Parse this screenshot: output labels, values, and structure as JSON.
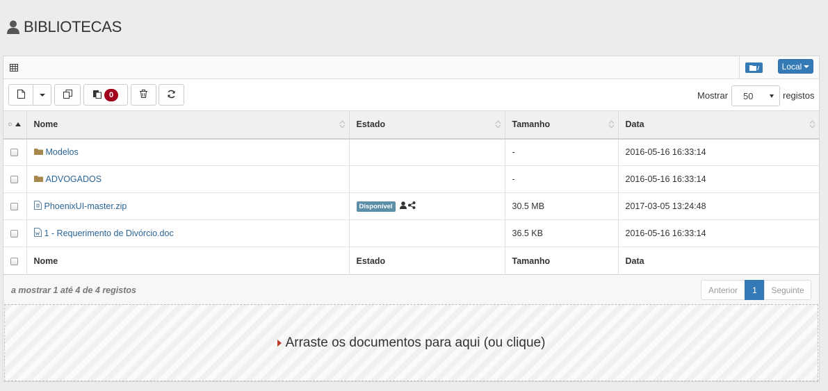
{
  "page": {
    "title": "BIBLIOTECAS"
  },
  "panel": {
    "location_button": "Local"
  },
  "toolbar": {
    "clipboard_count": "0",
    "show_label": "Mostrar",
    "page_size": "50",
    "records_label": "registos"
  },
  "table": {
    "columns": [
      "Nome",
      "Estado",
      "Tamanho",
      "Data"
    ],
    "rows": [
      {
        "name": "Modelos",
        "type": "folder",
        "status": "",
        "size": "-",
        "date": "2016-05-16 16:33:14"
      },
      {
        "name": "ADVOGADOS",
        "type": "folder",
        "status": "",
        "size": "-",
        "date": "2016-05-16 16:33:14"
      },
      {
        "name": "PhoenixUI-master.zip",
        "type": "zip",
        "status": "Disponível",
        "size": "30.5 MB",
        "date": "2017-03-05 13:24:48"
      },
      {
        "name": "1 - Requerimento de Divórcio.doc",
        "type": "doc",
        "status": "",
        "size": "36.5 KB",
        "date": "2016-05-16 16:33:14"
      }
    ]
  },
  "footer": {
    "info": "a mostrar 1 até 4 de 4 registos",
    "prev": "Anterior",
    "current_page": "1",
    "next": "Seguinte"
  },
  "dropzone": {
    "text": "Arraste os documentos para aqui (ou clique)"
  },
  "colors": {
    "accent": "#337ab7",
    "badge_red": "#a1001c",
    "status_badge": "#5b8fa8",
    "link": "#2a6496"
  }
}
